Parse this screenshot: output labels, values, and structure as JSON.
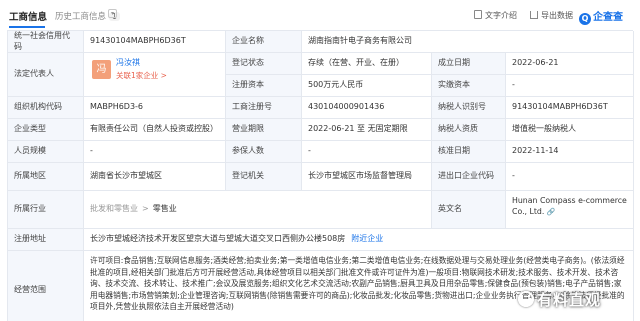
{
  "header": {
    "tab_active": "工商信息",
    "tab_history": "历史工商信息",
    "tab_history_count": "1",
    "tools": {
      "text_intro": "文字介绍",
      "export": "导出数据"
    },
    "brand_name": "企查查",
    "brand_logo_text": "Q"
  },
  "rows": {
    "r1": {
      "label_credit_code": "统一社会信用代码",
      "credit_code": "91430104MABPH6D36T",
      "label_name": "企业名称",
      "name": "湖南指南针电子商务有限公司"
    },
    "r2": {
      "label_legal": "法定代表人",
      "legal_avatar": "冯",
      "legal_name": "冯汝祺",
      "legal_link": "关联1家企业 >",
      "label_status": "登记状态",
      "status": "存续（在营、开业、在册）",
      "label_founded": "成立日期",
      "founded": "2022-06-21"
    },
    "r3": {
      "label_reg_capital": "注册资本",
      "reg_capital": "500万元人民币",
      "label_paid_capital": "实缴资本",
      "paid_capital": "-"
    },
    "r4": {
      "label_org_code": "组织机构代码",
      "org_code": "MABPH6D3-6",
      "label_reg_no": "工商注册号",
      "reg_no": "430104000901436",
      "label_taxpayer_id": "纳税人识别号",
      "taxpayer_id": "91430104MABPH6D36T"
    },
    "r5": {
      "label_type": "企业类型",
      "type": "有限责任公司（自然人投资或控股）",
      "label_term": "营业期限",
      "term": "2022-06-21 至 无固定期限",
      "label_tax_qual": "纳税人资质",
      "tax_qual": "增值税一般纳税人"
    },
    "r6": {
      "label_staff": "人员规模",
      "staff": "-",
      "label_insured": "参保人数",
      "insured": "-",
      "label_approve": "核准日期",
      "approve": "2022-11-14"
    },
    "r7": {
      "label_region": "所属地区",
      "region": "湖南省长沙市望城区",
      "label_authority": "登记机关",
      "authority": "长沙市望城区市场监督管理局",
      "label_ie_code": "进出口企业代码",
      "ie_code": "-"
    },
    "r8": {
      "label_industry": "所属行业",
      "industry_parent": "批发和零售业",
      "industry_sep": ">",
      "industry_child": "零售业",
      "label_en_name": "英文名",
      "en_name": "Hunan Compass e-commerce Co., Ltd.",
      "en_link": "🔗"
    },
    "r9": {
      "label_address": "注册地址",
      "address": "长沙市望城经济技术开发区望京大道与望城大道交叉口西侧办公楼508房",
      "address_link": "附近企业"
    },
    "r10": {
      "label_scope": "经营范围",
      "scope": "许可项目:食品销售;互联网信息服务;酒类经营;拍卖业务;第一类增值电信业务;第二类增值电信业务;在线数据处理与交易处理业务(经营类电子商务)。(依法须经批准的项目,经相关部门批准后方可开展经营活动,具体经营项目以相关部门批准文件或许可证件为准)一般项目:物联网技术研发;技术服务、技术开发、技术咨询、技术交流、技术转让、技术推广;会议及展览服务;组织文化艺术交流活动;农副产品销售;厨具卫具及日用杂品零售;保健食品(预包装)销售;电子产品销售;家用电器销售;市场营销策划;企业管理咨询;互联网销售(除销售需要许可的商品);化妆品批发;化妆品零售;货物进出口;企业业务执行管理服务。(除依法须经批准的项目外,凭营业执照依法自主开展经营活动)"
    }
  },
  "watermark": "有料直观"
}
